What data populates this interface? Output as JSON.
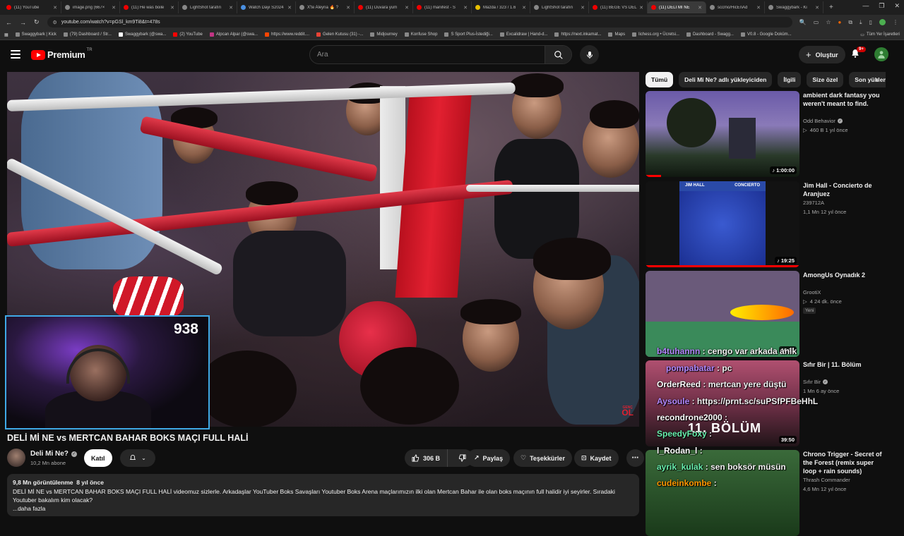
{
  "browser": {
    "tabs": [
      {
        "label": "(11) YouTube",
        "fav": "youtube"
      },
      {
        "label": "image.png (667×",
        "fav": "generic"
      },
      {
        "label": "(11) He was boile",
        "fav": "youtube"
      },
      {
        "label": "LightShot tarafın",
        "fav": "generic"
      },
      {
        "label": "Watch Dayi S2024",
        "fav": "blue"
      },
      {
        "label": "X'te Aleyna 🔥 ?",
        "fav": "generic"
      },
      {
        "label": "(11) Duvara yum",
        "fav": "youtube"
      },
      {
        "label": "(11) manifest - S",
        "fav": "youtube"
      },
      {
        "label": "Mazda / 323 / 1.6",
        "fav": "yellow"
      },
      {
        "label": "LightShot tarafın",
        "fav": "generic"
      },
      {
        "label": "(11) BEGE VS DEL",
        "fav": "youtube"
      },
      {
        "label": "(11) DELİ Mİ NE",
        "fav": "youtube",
        "active": true
      },
      {
        "label": "sccmo/HicEnAd",
        "fav": "generic"
      },
      {
        "label": "Swaggybark - Ki",
        "fav": "generic"
      }
    ],
    "url": "youtube.com/watch?v=pGSl_km9Ti8&t=478s",
    "bookmarks": [
      {
        "label": "Swaggybark | Kick",
        "fav": "kick"
      },
      {
        "label": "(79) Dashboard / Str...",
        "fav": "generic"
      },
      {
        "label": "Swaggybark (@swa...",
        "fav": "x"
      },
      {
        "label": "(2) YouTube",
        "fav": "youtube"
      },
      {
        "label": "Alpcan Alpar (@swa...",
        "fav": "instagram"
      },
      {
        "label": "https://www.reddit....",
        "fav": "reddit"
      },
      {
        "label": "Gelen Kutusu (31) -...",
        "fav": "gmail"
      },
      {
        "label": "Midjourney",
        "fav": "generic"
      },
      {
        "label": "Konfuse Shop",
        "fav": "generic"
      },
      {
        "label": "S Sport Plus-İstediği...",
        "fav": "generic"
      },
      {
        "label": "Excalidraw | Hand-d...",
        "fav": "generic"
      },
      {
        "label": "https://next.inkamat...",
        "fav": "generic"
      },
      {
        "label": "Maps",
        "fav": "generic"
      },
      {
        "label": "lichess.org • Ücretsi...",
        "fav": "generic"
      },
      {
        "label": "Dashboard - Swagg...",
        "fav": "generic"
      },
      {
        "label": "V0.8 - Google Doküm...",
        "fav": "generic"
      }
    ],
    "all_bookmarks": "Tüm Yer İşaretleri"
  },
  "header": {
    "logo": "Premium",
    "region": "TR",
    "search_placeholder": "Ara",
    "create_label": "Oluştur",
    "notifications": "9+"
  },
  "player": {
    "viewer_count": "938",
    "watermark": "GENÇ",
    "watermark_big": "OL"
  },
  "video": {
    "title": "DELİ Mİ NE vs MERTCAN BAHAR BOKS MAÇI FULL HALİ",
    "channel": "Deli Mi Ne?",
    "subscribers": "10,2 Mn abone",
    "join_label": "Katıl",
    "likes": "306 B",
    "share_label": "Paylaş",
    "thanks_label": "Teşekkürler",
    "save_label": "Kaydet",
    "views": "9,8 Mn görüntülenme",
    "age": "8 yıl önce",
    "description_line1": "DELİ Mİ NE vs MERTCAN BAHAR BOKS MAÇI FULL HALİ videomuz sizlerle. Arkadaşlar YouTuber Boks Savaşları Youtuber Boks Arena maçlarımızın ilki olan Mertcan Bahar ile olan boks maçının full halidir iyi seyirler. Sıradaki Youtuber bakalım kim olacak?",
    "description_line2": "...daha fazla"
  },
  "chips": [
    "Tümü",
    "Deli Mi Ne? adlı yükleyiciden",
    "İlgili",
    "Size özel",
    "Son yüklen"
  ],
  "recommendations": [
    {
      "title": "ambient dark fantasy you weren't meant to find.",
      "channel": "Odd Behavior",
      "verified": true,
      "meta": "460 B   1 yıl önce",
      "duration": "1:00:00",
      "progress": 0.1
    },
    {
      "title": "Jim Hall - Concierto de Aranjuez",
      "channel": "239712A",
      "verified": false,
      "meta": "1,1 Mn   12 yıl önce",
      "duration": "19:25",
      "progress": 1.0,
      "cover_left": "JIM HALL",
      "cover_right": "CONCIERTO"
    },
    {
      "title": "AmongUs Oynadık 2",
      "channel": "GrootiX",
      "verified": false,
      "meta": "4   24 dk. önce",
      "badge": "Yeni",
      "duration": "16:21"
    },
    {
      "title": "Sıfır Bir | 11. Bölüm",
      "channel": "Sıfır Bir",
      "verified": true,
      "meta": "1 Mn   6 ay önce",
      "duration": "39:50",
      "cover_text": "11. BÖLÜM"
    },
    {
      "title": "Chrono Trigger - Secret of the Forest (remix super loop + rain sounds)",
      "channel": "Thrash Commander",
      "verified": false,
      "meta": "4,6 Mn   12 yıl önce"
    }
  ],
  "chat": [
    {
      "user": "b4tuhannn",
      "msg": "cengo var arkada anlk",
      "color": "#b388ff"
    },
    {
      "user": "pompabatar",
      "msg": "pc",
      "color": "#b388ff"
    },
    {
      "user": "OrderReed",
      "msg": "mertcan yere düştü",
      "color": "#ffffff"
    },
    {
      "user": "Aysoule",
      "msg": "https://prnt.sc/suPSfPFBeHhL",
      "color": "#b388ff"
    },
    {
      "user": "recondrone2000",
      "msg": "",
      "color": "#ffffff"
    },
    {
      "user": "SpeedyFoxy",
      "msg": "",
      "color": "#69f0ae"
    },
    {
      "user": "l_Rodan_l",
      "msg": "",
      "color": "#ffffff"
    },
    {
      "user": "ayrik_kulak",
      "msg": "sen boksör müsün",
      "color": "#69f0ae"
    },
    {
      "user": "cudeinkombe",
      "msg": "",
      "color": "#ff9800"
    }
  ]
}
